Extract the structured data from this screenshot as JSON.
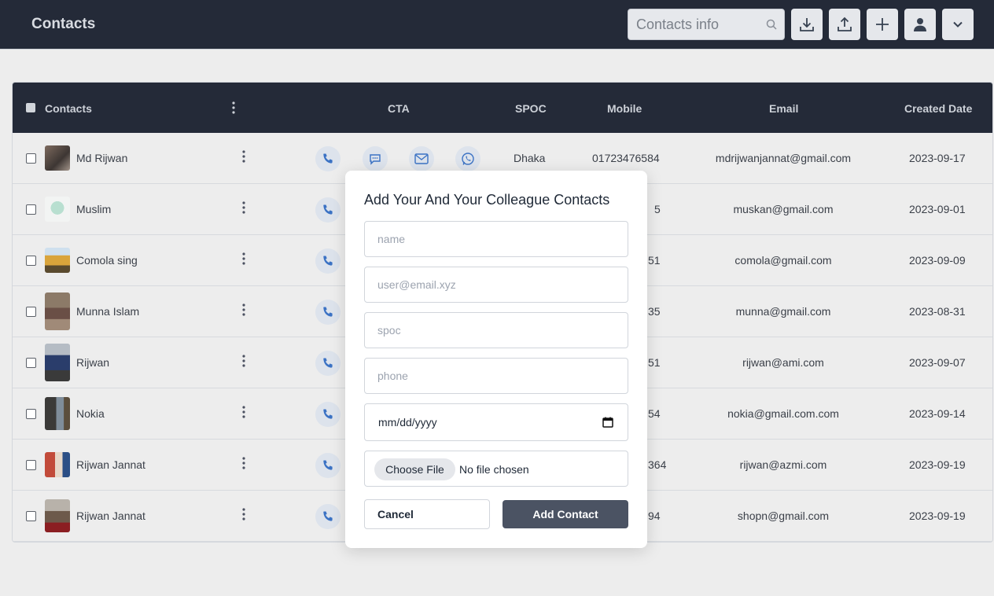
{
  "header": {
    "title": "Contacts",
    "search_placeholder": "Contacts info"
  },
  "table": {
    "columns": {
      "contacts": "Contacts",
      "cta": "CTA",
      "spoc": "SPOC",
      "mobile": "Mobile",
      "email": "Email",
      "created": "Created Date"
    },
    "rows": [
      {
        "name": "Md Rijwan",
        "spoc": "Dhaka",
        "mobile": "01723476584",
        "email": "mdrijwanjannat@gmail.com",
        "created": "2023-09-17"
      },
      {
        "name": "Muslim",
        "spoc": "",
        "mobile": "5",
        "email": "muskan@gmail.com",
        "created": "2023-09-01"
      },
      {
        "name": "Comola sing",
        "spoc": "",
        "mobile": "51",
        "email": "comola@gmail.com",
        "created": "2023-09-09"
      },
      {
        "name": "Munna Islam",
        "spoc": "",
        "mobile": "35",
        "email": "munna@gmail.com",
        "created": "2023-08-31"
      },
      {
        "name": "Rijwan",
        "spoc": "",
        "mobile": "51",
        "email": "rijwan@ami.com",
        "created": "2023-09-07"
      },
      {
        "name": "Nokia",
        "spoc": "",
        "mobile": "54",
        "email": "nokia@gmail.com.com",
        "created": "2023-09-14"
      },
      {
        "name": "Rijwan Jannat",
        "spoc": "",
        "mobile": "364",
        "email": "rijwan@azmi.com",
        "created": "2023-09-19"
      },
      {
        "name": "Rijwan Jannat",
        "spoc": "",
        "mobile": "94",
        "email": "shopn@gmail.com",
        "created": "2023-09-19"
      }
    ]
  },
  "modal": {
    "title": "Add Your And Your Colleague Contacts",
    "name_placeholder": "name",
    "email_placeholder": "user@email.xyz",
    "spoc_placeholder": "spoc",
    "phone_placeholder": "phone",
    "date_value": "mm/dd/yyyy",
    "file_button": "Choose File",
    "file_status": "No file chosen",
    "cancel_label": "Cancel",
    "add_label": "Add Contact"
  },
  "colors": {
    "header_bg": "#242a38",
    "primary_button": "#4b5363",
    "cta_accent": "#3b72c4"
  }
}
